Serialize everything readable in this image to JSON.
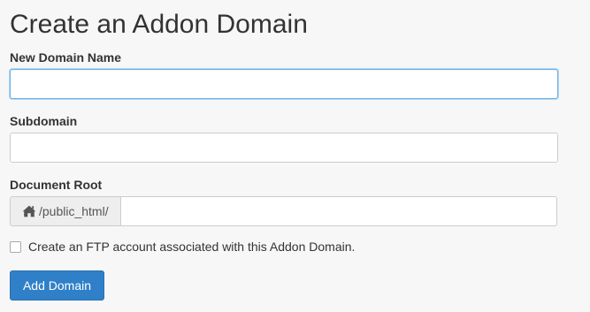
{
  "page_title": "Create an Addon Domain",
  "form": {
    "new_domain": {
      "label": "New Domain Name",
      "value": "",
      "placeholder": ""
    },
    "subdomain": {
      "label": "Subdomain",
      "value": "",
      "placeholder": ""
    },
    "document_root": {
      "label": "Document Root",
      "prefix": "/public_html/",
      "prefix_icon": "home-icon",
      "value": "",
      "placeholder": ""
    },
    "ftp_checkbox": {
      "label": "Create an FTP account associated with this Addon Domain.",
      "checked": false
    },
    "submit_label": "Add Domain"
  },
  "colors": {
    "background": "#f7f7f7",
    "primary_button": "#2f80c8",
    "focus_border": "#66afe9"
  }
}
